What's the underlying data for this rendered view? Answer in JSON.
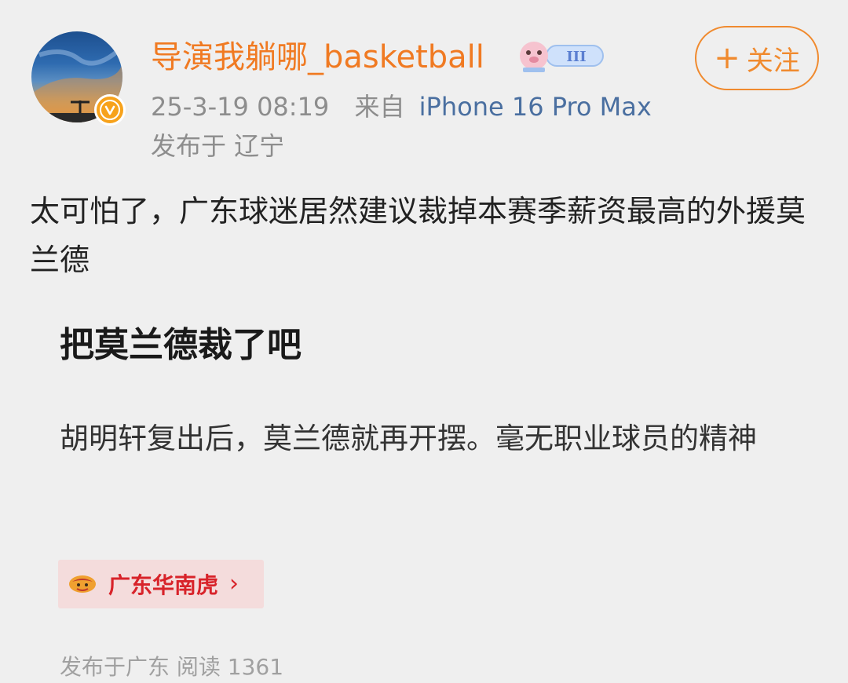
{
  "post": {
    "author": {
      "name": "导演我躺哪_basketball",
      "avatar_icon": "avatar-sunset-image",
      "verified_icon": "verified-v-icon",
      "member_badge_icon": "member-level-iii-badge-icon",
      "member_badge_text": "III"
    },
    "follow_button": {
      "icon": "+",
      "label": "关注"
    },
    "timestamp": "25-3-19 08:19",
    "source_prefix": "来自",
    "source_device": "iPhone 16 Pro Max",
    "location": "发布于 辽宁",
    "text": "太可怕了，广东球迷居然建议裁掉本赛季薪资最高的外援莫兰德"
  },
  "quoted_card": {
    "title": "把莫兰德裁了吧",
    "body": "胡明轩复出后，莫兰德就再开摆。毫无职业球员的精神",
    "topic": {
      "logo_icon": "team-logo-icon",
      "label": "广东华南虎",
      "chevron": "›"
    },
    "footer": "发布于广东  阅读 1361"
  },
  "colors": {
    "background": "#efefef",
    "username": "#f07a22",
    "follow_accent": "#f08a2e",
    "device_link": "#4a6fa0",
    "topic_red": "#d8232a",
    "topic_bg": "#f4dcdc",
    "verified": "#f7a21b"
  }
}
